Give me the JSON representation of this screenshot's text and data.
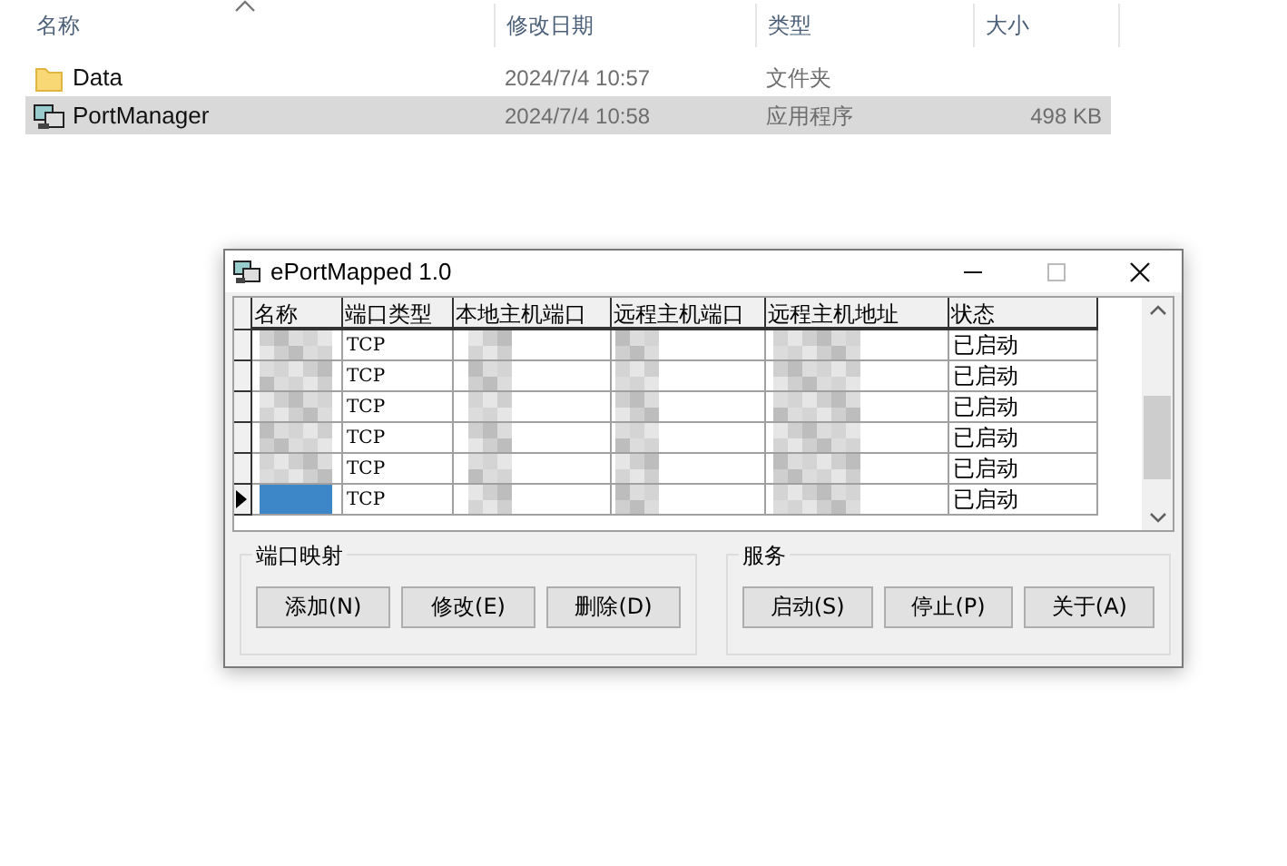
{
  "explorer": {
    "columns": [
      {
        "label": "名称",
        "sorted": true
      },
      {
        "label": "修改日期",
        "sorted": false
      },
      {
        "label": "类型",
        "sorted": false
      },
      {
        "label": "大小",
        "sorted": false
      }
    ],
    "files": [
      {
        "kind": "folder",
        "name": "Data",
        "modified": "2024/7/4 10:57",
        "type": "文件夹",
        "selected": false
      },
      {
        "kind": "app",
        "name": "PortManager",
        "modified": "2024/7/4 10:58",
        "type": "应用程序",
        "size": "498 KB",
        "selected": true
      }
    ]
  },
  "dialog": {
    "title": "ePortMapped 1.0",
    "grid": {
      "columns": [
        "名称",
        "端口类型",
        "本地主机端口",
        "远程主机端口",
        "远程主机地址",
        "状态"
      ],
      "rows": [
        {
          "port_type": "TCP",
          "status": "已启动",
          "selected": false
        },
        {
          "port_type": "TCP",
          "status": "已启动",
          "selected": false
        },
        {
          "port_type": "TCP",
          "status": "已启动",
          "selected": false
        },
        {
          "port_type": "TCP",
          "status": "已启动",
          "selected": false
        },
        {
          "port_type": "TCP",
          "status": "已启动",
          "selected": false
        },
        {
          "port_type": "TCP",
          "status": "已启动",
          "selected": true
        }
      ]
    },
    "groups": [
      {
        "title": "端口映射",
        "buttons": [
          "添加(N)",
          "修改(E)",
          "删除(D)"
        ]
      },
      {
        "title": "服务",
        "buttons": [
          "启动(S)",
          "停止(P)",
          "关于(A)"
        ]
      }
    ]
  }
}
